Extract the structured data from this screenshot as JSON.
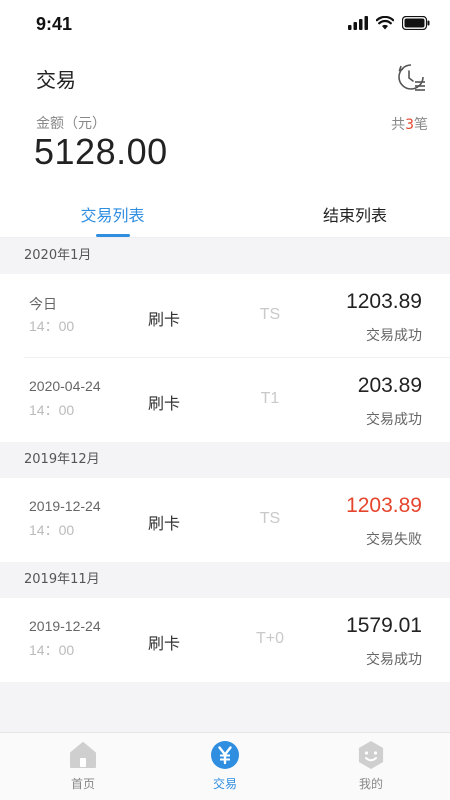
{
  "status_bar": {
    "time": "9:41"
  },
  "header": {
    "title": "交易"
  },
  "summary": {
    "amount_label": "金额（元）",
    "amount_value": "5128.00",
    "count_prefix": "共",
    "count_num": "3",
    "count_suffix": "笔"
  },
  "tabs": [
    {
      "label": "交易列表",
      "active": true
    },
    {
      "label": "结束列表",
      "active": false
    }
  ],
  "sections": [
    {
      "title": "2020年1月",
      "rows": [
        {
          "date": "今日",
          "time": "14：00",
          "type": "刷卡",
          "channel": "TS",
          "amount": "1203.89",
          "status": "交易成功"
        },
        {
          "date": "2020-04-24",
          "time": "14：00",
          "type": "刷卡",
          "channel": "T1",
          "amount": "203.89",
          "status": "交易成功"
        }
      ]
    },
    {
      "title": "2019年12月",
      "rows": [
        {
          "date": "2019-12-24",
          "time": "14：00",
          "type": "刷卡",
          "channel": "TS",
          "amount": "1203.89",
          "status": "交易失败"
        }
      ]
    },
    {
      "title": "2019年11月",
      "rows": [
        {
          "date": "2019-12-24",
          "time": "14：00",
          "type": "刷卡",
          "channel": "T+0",
          "amount": "1579.01",
          "status": "交易成功"
        }
      ]
    }
  ],
  "tabbar": [
    {
      "label": "首页",
      "icon": "home-icon",
      "active": false
    },
    {
      "label": "交易",
      "icon": "yen-icon",
      "active": true
    },
    {
      "label": "我的",
      "icon": "profile-face-icon",
      "active": false
    }
  ],
  "colors": {
    "accent": "#2f8ee0",
    "fail": "#e5452d",
    "icon_gray": "#cfcfcf"
  }
}
